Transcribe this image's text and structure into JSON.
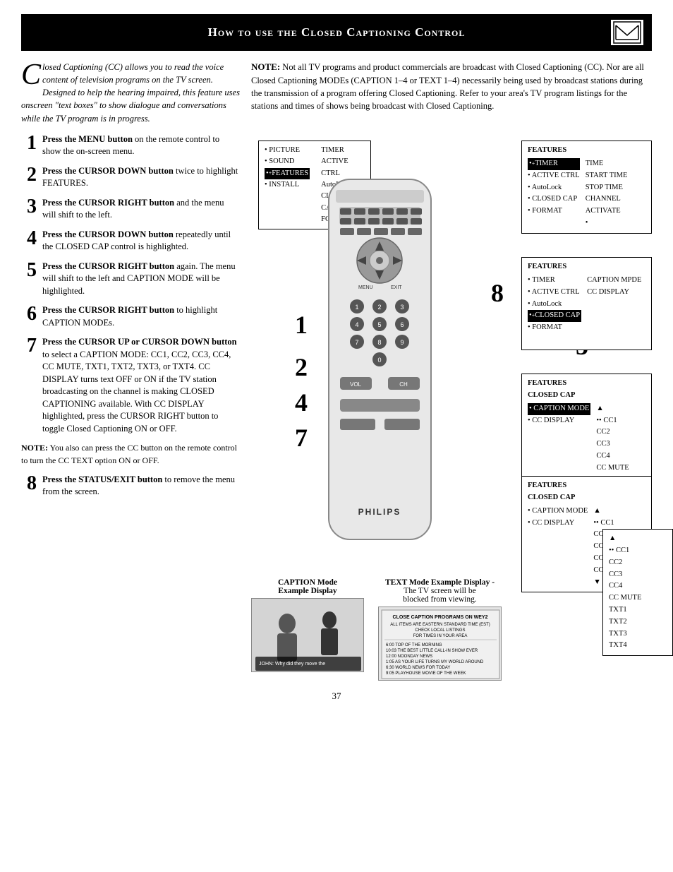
{
  "header": {
    "title": "How to use the Closed Captioning Control"
  },
  "intro": {
    "text": "losed Captioning (CC) allows you to read the voice content of television programs on the TV screen.  Designed to help the hearing impaired, this feature uses onscreen \"text boxes\" to show dialogue and conversations while the TV program is in progress."
  },
  "note_top": {
    "label": "NOTE:",
    "text": "  Not all TV programs and product commercials are broadcast with Closed Captioning (CC).  Nor are all Closed Captioning  MODEs (CAPTION 1–4 or TEXT 1–4) necessarily being used by broadcast stations during the transmission of a program offering Closed Captioning.  Refer to your area's TV program listings for the stations and times of shows being broadcast with Closed Captioning."
  },
  "steps": [
    {
      "num": "1",
      "text_bold": "Press the MENU button",
      "text": " on the remote control to show the on-screen menu."
    },
    {
      "num": "2",
      "text_bold": "Press the CURSOR DOWN button",
      "text": " twice to highlight FEATURES."
    },
    {
      "num": "3",
      "text_bold": "Press the CURSOR RIGHT button",
      "text": " and the menu will shift to the left."
    },
    {
      "num": "4",
      "text_bold": "Press the CURSOR DOWN button",
      "text": " repeatedly until the CLOSED CAP control is highlighted."
    },
    {
      "num": "5",
      "text_bold": "Press the CURSOR RIGHT button",
      "text": " again. The menu will shift to the left and CAPTION MODE will be highlighted."
    },
    {
      "num": "6",
      "text_bold": "Press the CURSOR RIGHT button",
      "text": " to highlight CAPTION MODEs."
    },
    {
      "num": "7",
      "text_bold": "Press the CURSOR UP or CURSOR DOWN button",
      "text": " to select a CAPTION MODE:  CC1, CC2, CC3, CC4, CC MUTE, TXT1, TXT2, TXT3, or TXT4.  CC DISPLAY turns text OFF or ON if the TV station broadcasting on the channel is making CLOSED CAPTIONING available. With CC DISPLAY highlighted, press the CURSOR RIGHT button to toggle Closed Captioning ON or OFF."
    }
  ],
  "note_bottom": {
    "label": "NOTE:",
    "text": " You also can press the CC button on the remote control to turn the CC TEXT option ON or OFF."
  },
  "step8": {
    "num": "8",
    "text_bold": "Press the STATUS/EXIT button",
    "text": " to remove the menu from the screen."
  },
  "menus": [
    {
      "id": "menu1",
      "title": "FEATURES",
      "items_left": [
        "•TIMER",
        "• ACTIVE CTRL",
        "• AutoLock",
        "• CLOSED CAP",
        "• FORMAT",
        ""
      ],
      "items_right": [
        "TIME",
        "START TIME",
        "STOP TIME",
        "CHANNEL",
        "ACTIVATE",
        ""
      ],
      "highlighted_left": "•TIMER"
    },
    {
      "id": "menu2",
      "title": "FEATURES",
      "items_left": [
        "• TIMER",
        "• ACTIVE CTRL",
        "• AutoLock",
        "•+CLOSED CAP",
        "• FORMAT",
        ""
      ],
      "items_right": [
        "CAPTION MPDE",
        "CC DISPLAY",
        "",
        "",
        "",
        ""
      ],
      "highlighted_left": "•+CLOSED CAP"
    },
    {
      "id": "menu3",
      "title": "FEATURES\nCLOSED CAP",
      "items_left": [
        "• CAPTION MODE",
        "• CC DISPLAY"
      ],
      "items_right": [
        "•• CC1",
        "CC2",
        "CC3",
        "CC4",
        "CC MUTE",
        "▼"
      ],
      "highlighted_left": "• CAPTION MODE"
    },
    {
      "id": "menu4",
      "title": "FEATURES\nCLOSED CAP",
      "items_left": [
        "• CAPTION MODE",
        "• CC DISPLAY"
      ],
      "items_right": [
        "•• CC1",
        "CC2",
        "CC3",
        "CC4",
        "CC MUTE",
        "▼"
      ],
      "highlighted_left": ""
    }
  ],
  "menu_main": {
    "items_left": [
      "• PICTURE",
      "• SOUND",
      "•+FEATURES",
      "• INSTALL"
    ],
    "items_right": [
      "TIMER",
      "ACTIVE CTRL",
      "AutoLock",
      "CLOSED CAP",
      "FORMAT"
    ],
    "highlighted": "•+FEATURES"
  },
  "caption_examples": [
    {
      "label1": "CAPTION Mode",
      "label2": "Example Display",
      "description": "Shows two people with caption text"
    },
    {
      "label1": "TEXT  Mode Example Display -",
      "label2": "The TV screen will be blocked from viewing.",
      "description": "Shows text program listing"
    }
  ],
  "page_number": "37",
  "remote": {
    "brand": "PHILIPS"
  }
}
